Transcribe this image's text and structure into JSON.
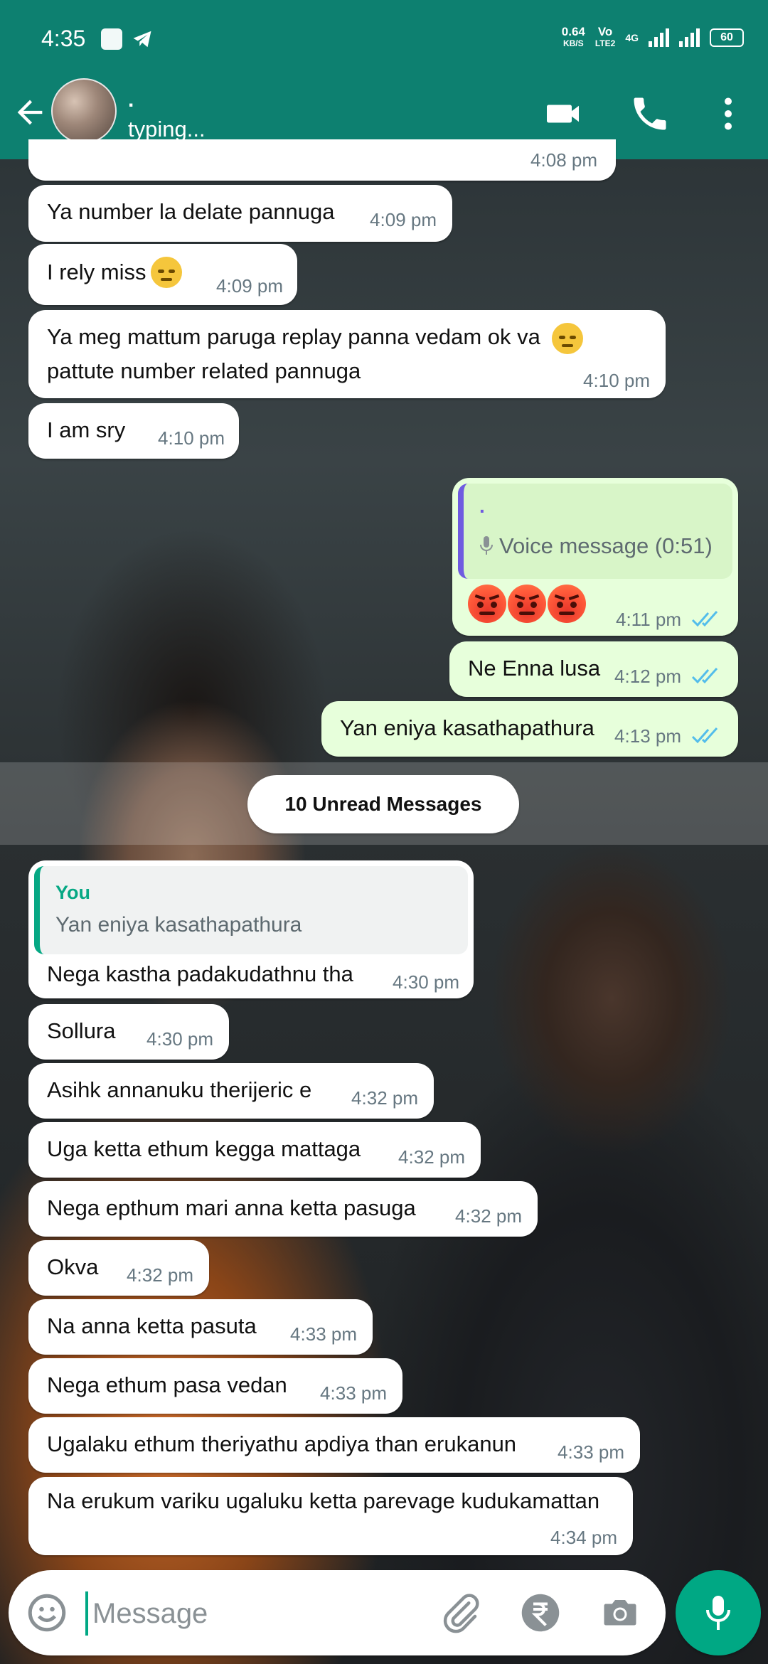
{
  "status_bar": {
    "time": "4:35",
    "speed_value": "0.64",
    "speed_unit": "KB/S",
    "volte_top": "Vo",
    "volte_bottom": "LTE2",
    "network": "4G",
    "battery": "60"
  },
  "header": {
    "contact_name": ".",
    "contact_status": "typing..."
  },
  "messages_before": [
    {
      "text": "Ya number la delate pannuga",
      "time": "4:09 pm"
    },
    {
      "text": "I rely miss",
      "time": "4:09 pm"
    },
    {
      "line1": "Ya meg mattum paruga replay panna vedam ok va",
      "line2": "pattute number related pannuga",
      "time": "4:10 pm"
    },
    {
      "text": "I am sry",
      "time": "4:10 pm"
    }
  ],
  "partial_top_time": "4:08 pm",
  "outgoing": [
    {
      "quote_name": ".",
      "voice_label": "Voice message (0:51)",
      "time": "4:11 pm"
    },
    {
      "text": "Ne Enna lusa",
      "time": "4:12 pm"
    },
    {
      "text": "Yan eniya kasathapathura",
      "time": "4:13 pm"
    }
  ],
  "unread_label": "10 Unread Messages",
  "reply": {
    "quote_author": "You",
    "quote_text": "Yan eniya kasathapathura",
    "text": "Nega kastha padakudathnu tha",
    "time": "4:30 pm"
  },
  "messages_after": [
    {
      "text": "Sollura",
      "time": "4:30 pm"
    },
    {
      "text": "Asihk annanuku therijeric e",
      "time": "4:32 pm"
    },
    {
      "text": "Uga ketta ethum kegga mattaga",
      "time": "4:32 pm"
    },
    {
      "text": "Nega epthum mari anna ketta pasuga",
      "time": "4:32 pm"
    },
    {
      "text": "Okva",
      "time": "4:32 pm"
    },
    {
      "text": "Na anna ketta pasuta",
      "time": "4:33 pm"
    },
    {
      "text": "Nega ethum pasa vedan",
      "time": "4:33 pm"
    },
    {
      "text": "Ugalaku ethum theriyathu apdiya than erukanun",
      "time": "4:33 pm"
    },
    {
      "text": "Na erukum variku ugaluku ketta parevage kudukamattan",
      "time": "4:34 pm"
    }
  ],
  "composer": {
    "placeholder": "Message"
  },
  "colors": {
    "header": "#0d8070",
    "accent": "#00a884",
    "outgoing_bubble": "#e7ffdb",
    "read_ticks": "#53bdeb"
  },
  "icons": [
    "back-arrow-icon",
    "video-call-icon",
    "voice-call-icon",
    "more-options-icon",
    "emoji-icon",
    "attach-icon",
    "rupee-payment-icon",
    "camera-icon",
    "mic-icon",
    "double-check-icon",
    "microphone-small-icon"
  ]
}
